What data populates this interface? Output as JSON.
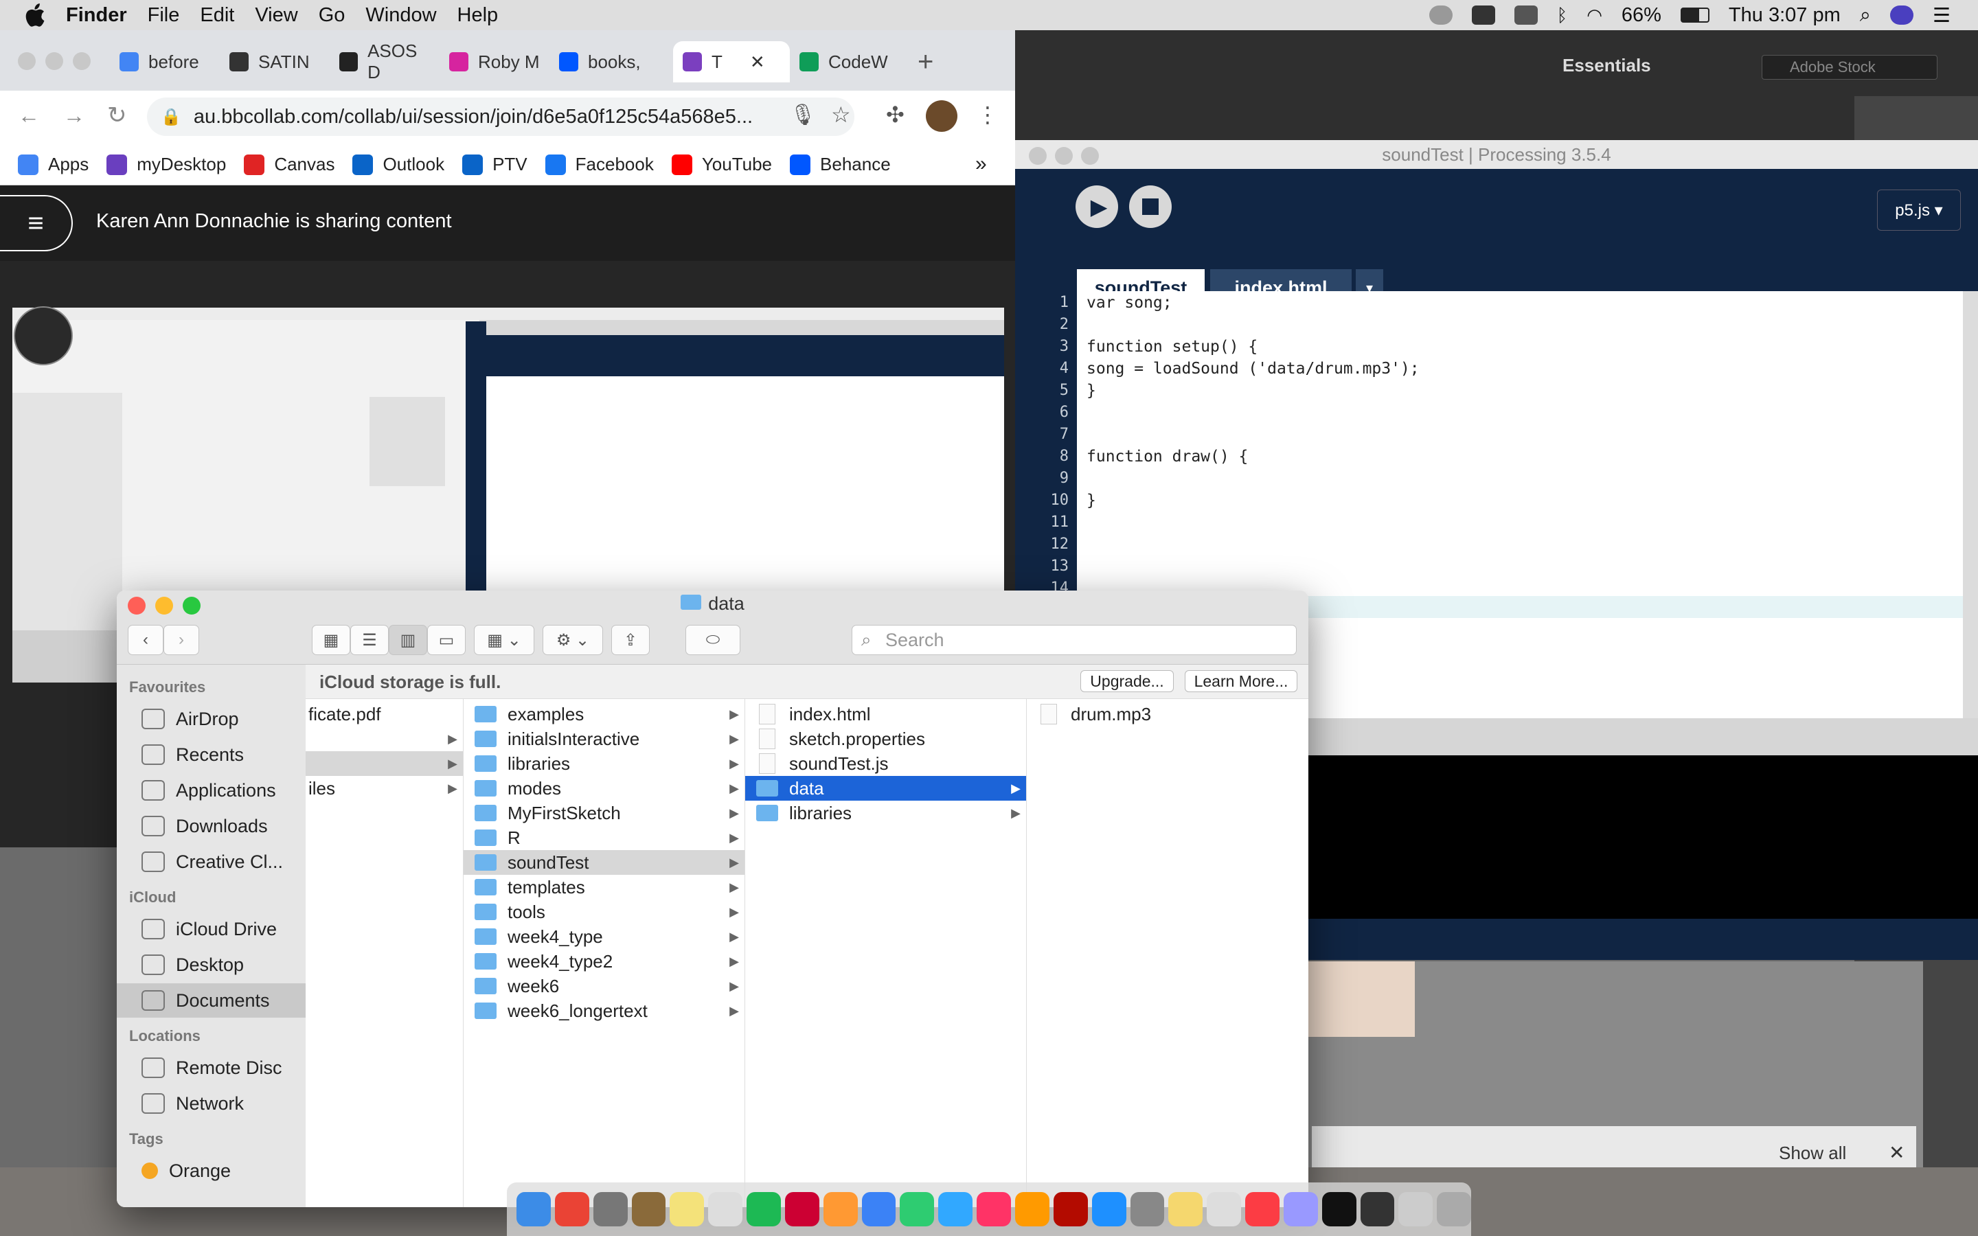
{
  "menubar": {
    "app": "Finder",
    "items": [
      "File",
      "Edit",
      "View",
      "Go",
      "Window",
      "Help"
    ],
    "battery": "66%",
    "clock": "Thu 3:07 pm"
  },
  "chrome": {
    "tabs": [
      {
        "label": "before",
        "color": "#4285f4"
      },
      {
        "label": "SATIN",
        "color": "#333"
      },
      {
        "label": "ASOS D",
        "color": "#222"
      },
      {
        "label": "Roby M",
        "color": "#d6249f"
      },
      {
        "label": "books,",
        "color": "#0057ff"
      },
      {
        "label": "T",
        "color": "#7b3fbf"
      },
      {
        "label": "CodeW",
        "color": "#0f9d58"
      }
    ],
    "url": "au.bbcollab.com/collab/ui/session/join/d6e5a0f125c54a568e5...",
    "bookmarks": [
      {
        "label": "Apps",
        "color": "#4285f4"
      },
      {
        "label": "myDesktop",
        "color": "#6a3fbf"
      },
      {
        "label": "Canvas",
        "color": "#e02424"
      },
      {
        "label": "Outlook",
        "color": "#0a64c8"
      },
      {
        "label": "PTV",
        "color": "#0a64c8"
      },
      {
        "label": "Facebook",
        "color": "#1877f2"
      },
      {
        "label": "YouTube",
        "color": "#ff0000"
      },
      {
        "label": "Behance",
        "color": "#0057ff"
      }
    ],
    "sharing": "Karen Ann Donnachie is sharing content",
    "more": "»"
  },
  "photoshop": {
    "workspace": "Essentials",
    "search_placeholder": "Adobe Stock",
    "show_all": "Show all"
  },
  "processing": {
    "title": "soundTest | Processing 3.5.4",
    "mode": "p5.js ▾",
    "tabs": [
      "soundTest",
      "index.html"
    ],
    "lines": [
      "var song;",
      "",
      "function setup() {",
      "song = loadSound ('data/drum.mp3');",
      "}",
      "",
      "",
      "function draw() {",
      "",
      "}",
      "",
      "",
      "",
      ""
    ]
  },
  "finder": {
    "title": "data",
    "search_placeholder": "Search",
    "icloud_msg": "iCloud storage is full.",
    "upgrade": "Upgrade...",
    "learn_more": "Learn More...",
    "sidebar": {
      "favourites_label": "Favourites",
      "favourites": [
        "AirDrop",
        "Recents",
        "Applications",
        "Downloads",
        "Creative Cl..."
      ],
      "icloud_label": "iCloud",
      "icloud": [
        "iCloud Drive",
        "Desktop",
        "Documents"
      ],
      "locations_label": "Locations",
      "locations": [
        "Remote Disc",
        "Network"
      ],
      "tags_label": "Tags",
      "tags": [
        "Orange"
      ]
    },
    "col1": [
      "ficate.pdf",
      "",
      "",
      "iles"
    ],
    "col2": [
      "examples",
      "initialsInteractive",
      "libraries",
      "modes",
      "MyFirstSketch",
      "R",
      "soundTest",
      "templates",
      "tools",
      "week4_type",
      "week4_type2",
      "week6",
      "week6_longertext"
    ],
    "col3": [
      {
        "name": "index.html",
        "type": "doc"
      },
      {
        "name": "sketch.properties",
        "type": "doc"
      },
      {
        "name": "soundTest.js",
        "type": "doc"
      },
      {
        "name": "data",
        "type": "folder"
      },
      {
        "name": "libraries",
        "type": "folder"
      }
    ],
    "col4": [
      "drum.mp3"
    ]
  },
  "dock": {
    "apps": [
      "#3c8ce7",
      "#ea4335",
      "#777",
      "#8a6a3a",
      "#f4e27a",
      "#ddd",
      "#1db954",
      "#c03",
      "#f93",
      "#3b82f6",
      "#2ecc71",
      "#31a8ff",
      "#ff3366",
      "#ff9a00",
      "#b30b00",
      "#1e90ff",
      "#888",
      "#f5d76e",
      "#ddd",
      "#fc3c44",
      "#9999ff",
      "#111",
      "#333",
      "#ccc",
      "#aaa"
    ]
  }
}
